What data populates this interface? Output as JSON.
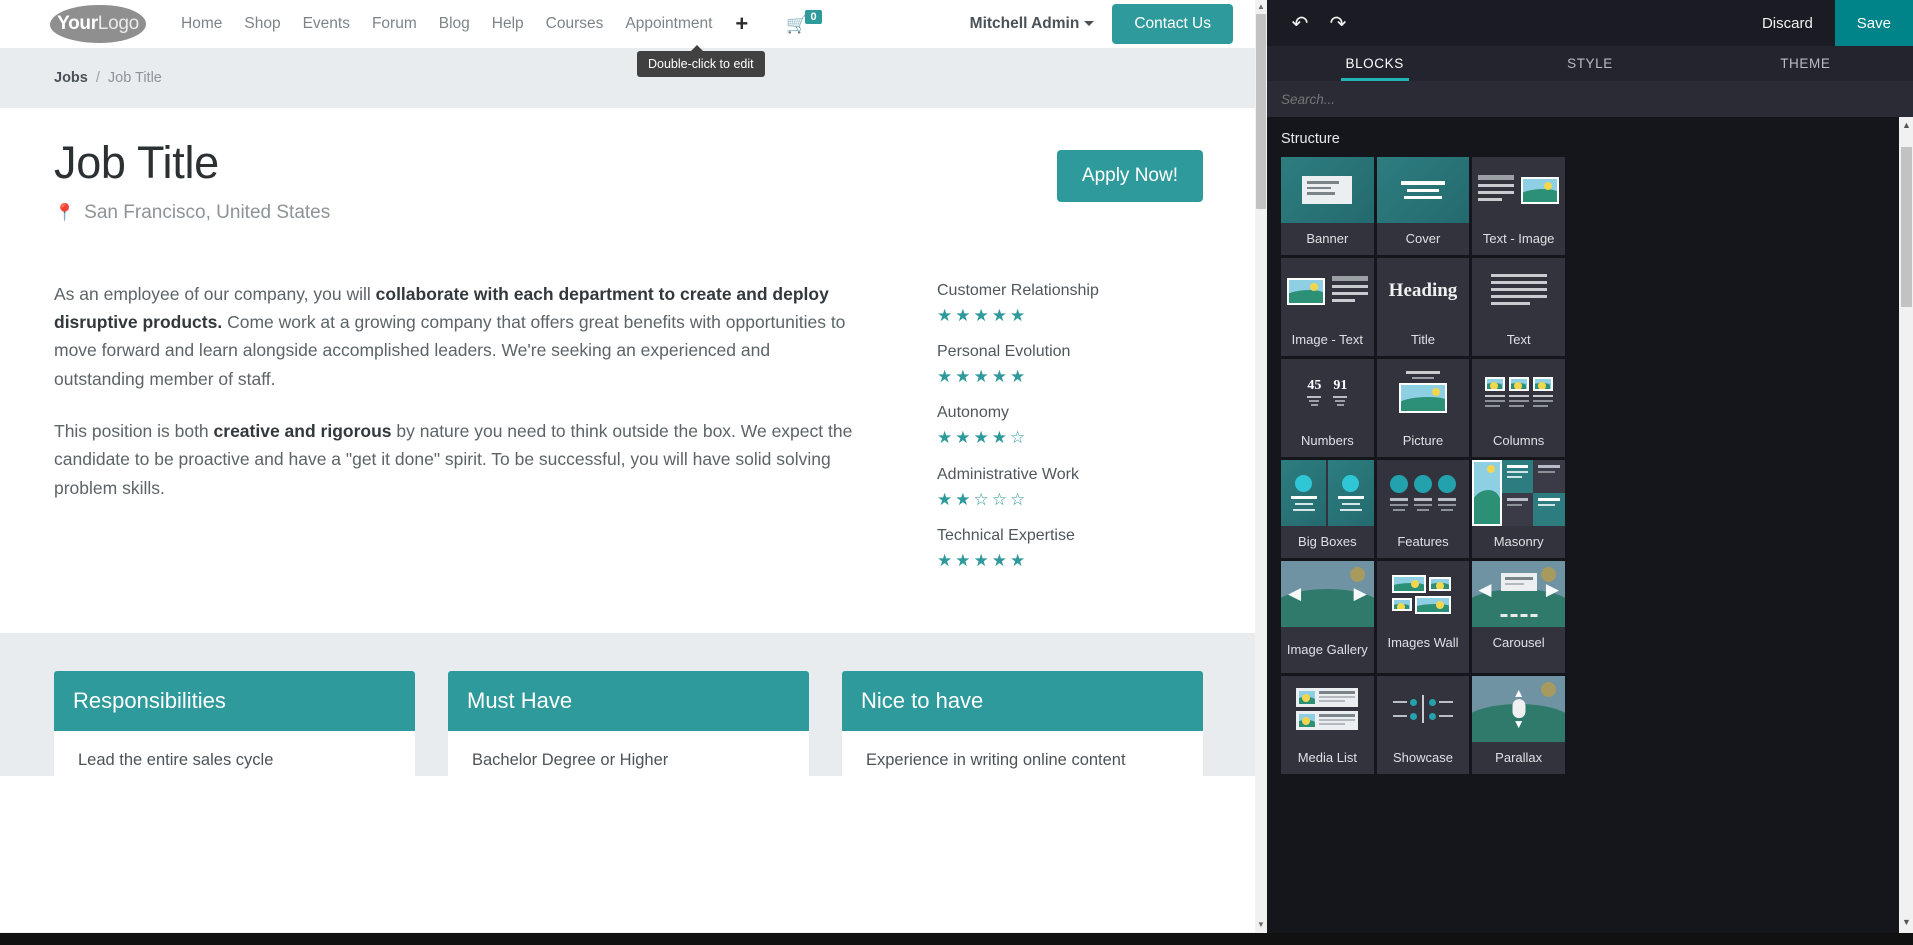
{
  "website": {
    "logo": {
      "bold": "Your",
      "light": "Logo"
    },
    "nav": [
      {
        "label": "Home"
      },
      {
        "label": "Shop"
      },
      {
        "label": "Events"
      },
      {
        "label": "Forum"
      },
      {
        "label": "Blog"
      },
      {
        "label": "Help"
      },
      {
        "label": "Courses"
      },
      {
        "label": "Appointment"
      }
    ],
    "plus_icon": "+",
    "cart": {
      "icon": "cart-icon",
      "count": "0"
    },
    "user": "Mitchell Admin",
    "contact_button": "Contact Us",
    "tooltip": "Double-click to edit",
    "breadcrumb": {
      "parent": "Jobs",
      "separator": "/",
      "current": "Job Title"
    },
    "hero": {
      "title": "Job Title",
      "location": "San Francisco, United States",
      "location_icon": "map-pin-icon",
      "apply_button": "Apply Now!"
    },
    "description": [
      {
        "parts": [
          {
            "text": "As an employee of our company, you will ",
            "bold": false
          },
          {
            "text": "collaborate with each department to create and deploy disruptive products.",
            "bold": true
          },
          {
            "text": " Come work at a growing company that offers great benefits with opportunities to move forward and learn alongside accomplished leaders. We're seeking an experienced and outstanding member of staff.",
            "bold": false
          }
        ]
      },
      {
        "parts": [
          {
            "text": "This position is both ",
            "bold": false
          },
          {
            "text": "creative and rigorous",
            "bold": true
          },
          {
            "text": " by nature you need to think outside the box. We expect the candidate to be proactive and have a \"get it done\" spirit. To be successful, you will have solid solving problem skills.",
            "bold": false
          }
        ]
      }
    ],
    "skills": [
      {
        "name": "Customer Relationship",
        "rating": 5,
        "max": 5
      },
      {
        "name": "Personal Evolution",
        "rating": 5,
        "max": 5
      },
      {
        "name": "Autonomy",
        "rating": 4,
        "max": 5
      },
      {
        "name": "Administrative Work",
        "rating": 2,
        "max": 5
      },
      {
        "name": "Technical Expertise",
        "rating": 5,
        "max": 5
      }
    ],
    "cards": [
      {
        "title": "Responsibilities",
        "items": [
          "Lead the entire sales cycle"
        ]
      },
      {
        "title": "Must Have",
        "items": [
          "Bachelor Degree or Higher"
        ]
      },
      {
        "title": "Nice to have",
        "items": [
          "Experience in writing online content"
        ]
      }
    ]
  },
  "editor": {
    "undo_icon": "undo-icon",
    "redo_icon": "redo-icon",
    "discard_label": "Discard",
    "save_label": "Save",
    "tabs": [
      {
        "label": "BLOCKS",
        "active": true
      },
      {
        "label": "STYLE",
        "active": false
      },
      {
        "label": "THEME",
        "active": false
      }
    ],
    "search_placeholder": "Search...",
    "section_title": "Structure",
    "blocks": [
      {
        "label": "Banner",
        "thumb": "banner"
      },
      {
        "label": "Cover",
        "thumb": "cover"
      },
      {
        "label": "Text - Image",
        "thumb": "text-image"
      },
      {
        "label": "Image - Text",
        "thumb": "image-text"
      },
      {
        "label": "Title",
        "thumb": "title"
      },
      {
        "label": "Text",
        "thumb": "text"
      },
      {
        "label": "Numbers",
        "thumb": "numbers"
      },
      {
        "label": "Picture",
        "thumb": "picture"
      },
      {
        "label": "Columns",
        "thumb": "columns"
      },
      {
        "label": "Big Boxes",
        "thumb": "big-boxes"
      },
      {
        "label": "Features",
        "thumb": "features"
      },
      {
        "label": "Masonry",
        "thumb": "masonry"
      },
      {
        "label": "Image Gallery",
        "thumb": "image-gallery"
      },
      {
        "label": "Images Wall",
        "thumb": "images-wall"
      },
      {
        "label": "Carousel",
        "thumb": "carousel"
      },
      {
        "label": "Media List",
        "thumb": "media-list"
      },
      {
        "label": "Showcase",
        "thumb": "showcase"
      },
      {
        "label": "Parallax",
        "thumb": "parallax"
      }
    ],
    "numbers_thumb": {
      "a": "45",
      "b": "91"
    },
    "title_thumb_text": "Heading"
  },
  "colors": {
    "accent": "#2f9a9b",
    "save": "#01838a",
    "panel": "#24242e",
    "panel_dark": "#15151c",
    "tile": "#33333e",
    "band": "#e9ecef"
  }
}
